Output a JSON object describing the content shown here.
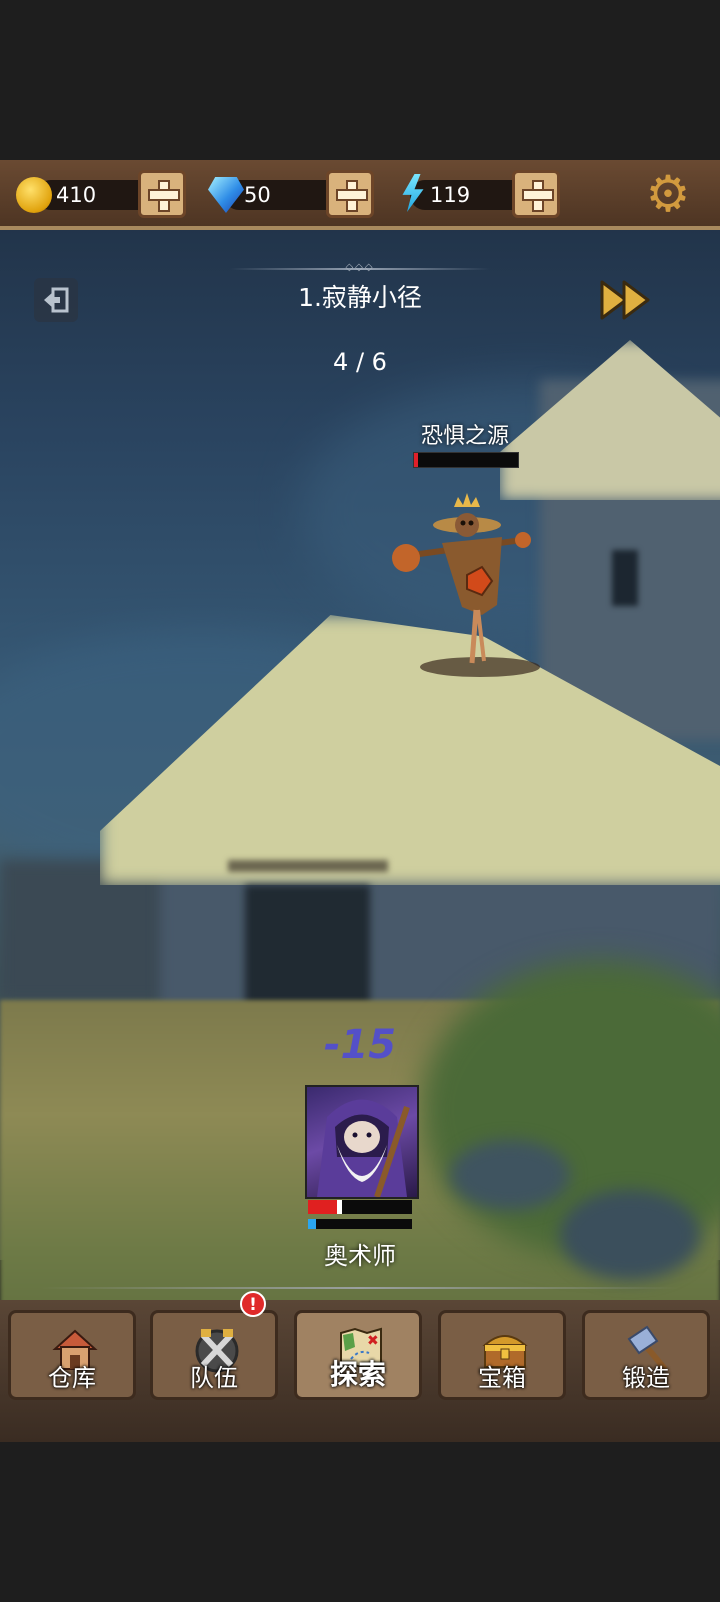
{
  "resources": {
    "gold": {
      "value": "410",
      "icon": "gold-coin-icon"
    },
    "gems": {
      "value": "50",
      "icon": "diamond-icon"
    },
    "energy": {
      "value": "119",
      "icon": "lightning-icon"
    }
  },
  "level": {
    "title": "1.寂静小径",
    "progress": "4 / 6"
  },
  "enemy": {
    "name": "恐惧之源",
    "hp_fraction": 0.04
  },
  "hero": {
    "name": "奥术师",
    "damage_text": "-15",
    "hp_fraction": 0.33,
    "mp_fraction": 0.08
  },
  "nav": {
    "tabs": [
      {
        "label": "仓库",
        "icon": "house-icon",
        "active": false
      },
      {
        "label": "队伍",
        "icon": "crossed-swords-icon",
        "active": false,
        "badge": "!"
      },
      {
        "label": "探索",
        "icon": "map-icon",
        "active": true
      },
      {
        "label": "宝箱",
        "icon": "treasure-chest-icon",
        "active": false
      },
      {
        "label": "锻造",
        "icon": "hammer-icon",
        "active": false
      }
    ]
  },
  "colors": {
    "damage": "#5450c8",
    "hp": "#e02020",
    "mp": "#2aa6f0",
    "frame": "#6a4a32"
  }
}
